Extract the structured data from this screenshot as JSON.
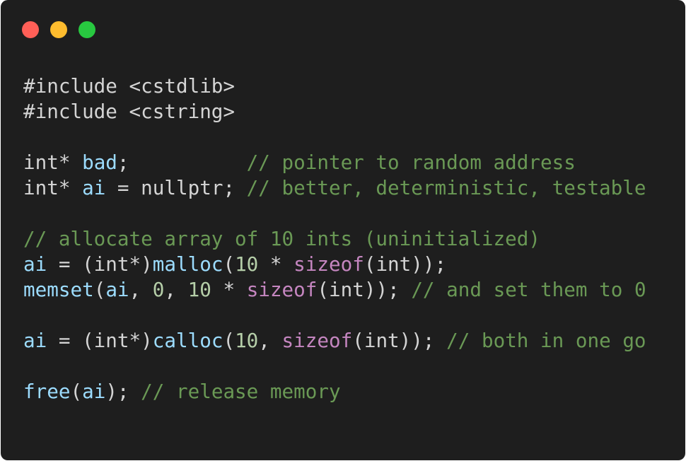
{
  "window": {
    "controls": [
      "close",
      "minimize",
      "zoom"
    ],
    "colors": {
      "background": "#1e1e1e",
      "close": "#ff5f57",
      "minimize": "#febc2e",
      "zoom": "#28c840",
      "plain": "#d4d4d4",
      "identifier": "#9cdcfe",
      "number": "#b5cea8",
      "keyword": "#c586c0",
      "comment": "#6a9955"
    }
  },
  "code": {
    "language": "C++",
    "lines": [
      [
        {
          "t": "plain",
          "v": "#include <cstdlib>"
        }
      ],
      [
        {
          "t": "plain",
          "v": "#include <cstring>"
        }
      ],
      [],
      [
        {
          "t": "plain",
          "v": "int* "
        },
        {
          "t": "var",
          "v": "bad"
        },
        {
          "t": "plain",
          "v": ";          "
        },
        {
          "t": "comment",
          "v": "// pointer to random address"
        }
      ],
      [
        {
          "t": "plain",
          "v": "int* "
        },
        {
          "t": "var",
          "v": "ai"
        },
        {
          "t": "plain",
          "v": " = nullptr; "
        },
        {
          "t": "comment",
          "v": "// better, deterministic, testable"
        }
      ],
      [],
      [
        {
          "t": "comment",
          "v": "// allocate array of 10 ints (uninitialized)"
        }
      ],
      [
        {
          "t": "var",
          "v": "ai"
        },
        {
          "t": "plain",
          "v": " = (int*)"
        },
        {
          "t": "func",
          "v": "malloc"
        },
        {
          "t": "plain",
          "v": "("
        },
        {
          "t": "num",
          "v": "10"
        },
        {
          "t": "plain",
          "v": " * "
        },
        {
          "t": "kw",
          "v": "sizeof"
        },
        {
          "t": "plain",
          "v": "(int));"
        }
      ],
      [
        {
          "t": "func",
          "v": "memset"
        },
        {
          "t": "plain",
          "v": "("
        },
        {
          "t": "var",
          "v": "ai"
        },
        {
          "t": "plain",
          "v": ", "
        },
        {
          "t": "num",
          "v": "0"
        },
        {
          "t": "plain",
          "v": ", "
        },
        {
          "t": "num",
          "v": "10"
        },
        {
          "t": "plain",
          "v": " * "
        },
        {
          "t": "kw",
          "v": "sizeof"
        },
        {
          "t": "plain",
          "v": "(int)); "
        },
        {
          "t": "comment",
          "v": "// and set them to 0"
        }
      ],
      [],
      [
        {
          "t": "var",
          "v": "ai"
        },
        {
          "t": "plain",
          "v": " = (int*)"
        },
        {
          "t": "func",
          "v": "calloc"
        },
        {
          "t": "plain",
          "v": "("
        },
        {
          "t": "num",
          "v": "10"
        },
        {
          "t": "plain",
          "v": ", "
        },
        {
          "t": "kw",
          "v": "sizeof"
        },
        {
          "t": "plain",
          "v": "(int)); "
        },
        {
          "t": "comment",
          "v": "// both in one go"
        }
      ],
      [],
      [
        {
          "t": "func",
          "v": "free"
        },
        {
          "t": "plain",
          "v": "("
        },
        {
          "t": "var",
          "v": "ai"
        },
        {
          "t": "plain",
          "v": "); "
        },
        {
          "t": "comment",
          "v": "// release memory"
        }
      ]
    ]
  }
}
